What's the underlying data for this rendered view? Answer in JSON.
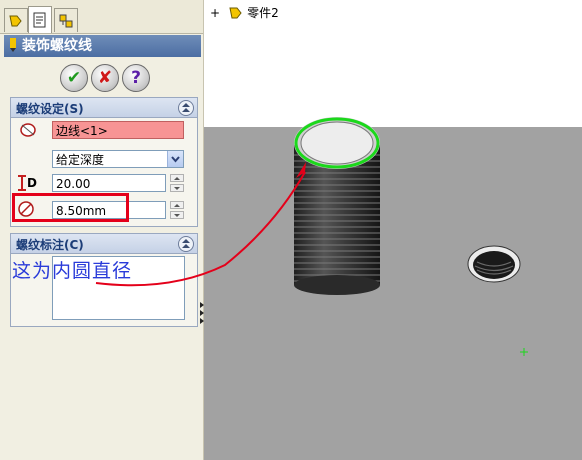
{
  "tree": {
    "expand": "+",
    "part_name": "零件2"
  },
  "panel": {
    "title": "装饰螺纹线",
    "buttons": {
      "ok": "✔",
      "cancel": "✘",
      "help": "?"
    }
  },
  "thread_settings": {
    "heading": "螺纹设定(S)",
    "edge": "边线<1>",
    "end_condition": "给定深度",
    "depth_label": "D",
    "depth": "20.00",
    "diameter": "8.50mm"
  },
  "thread_callout": {
    "heading": "螺纹标注(C)"
  },
  "annotation": "这为内圆直径",
  "colors": {
    "highlight_box": "#e4001a",
    "annotation_text": "#2a3bd9",
    "edge_select": "#1bd81b"
  }
}
